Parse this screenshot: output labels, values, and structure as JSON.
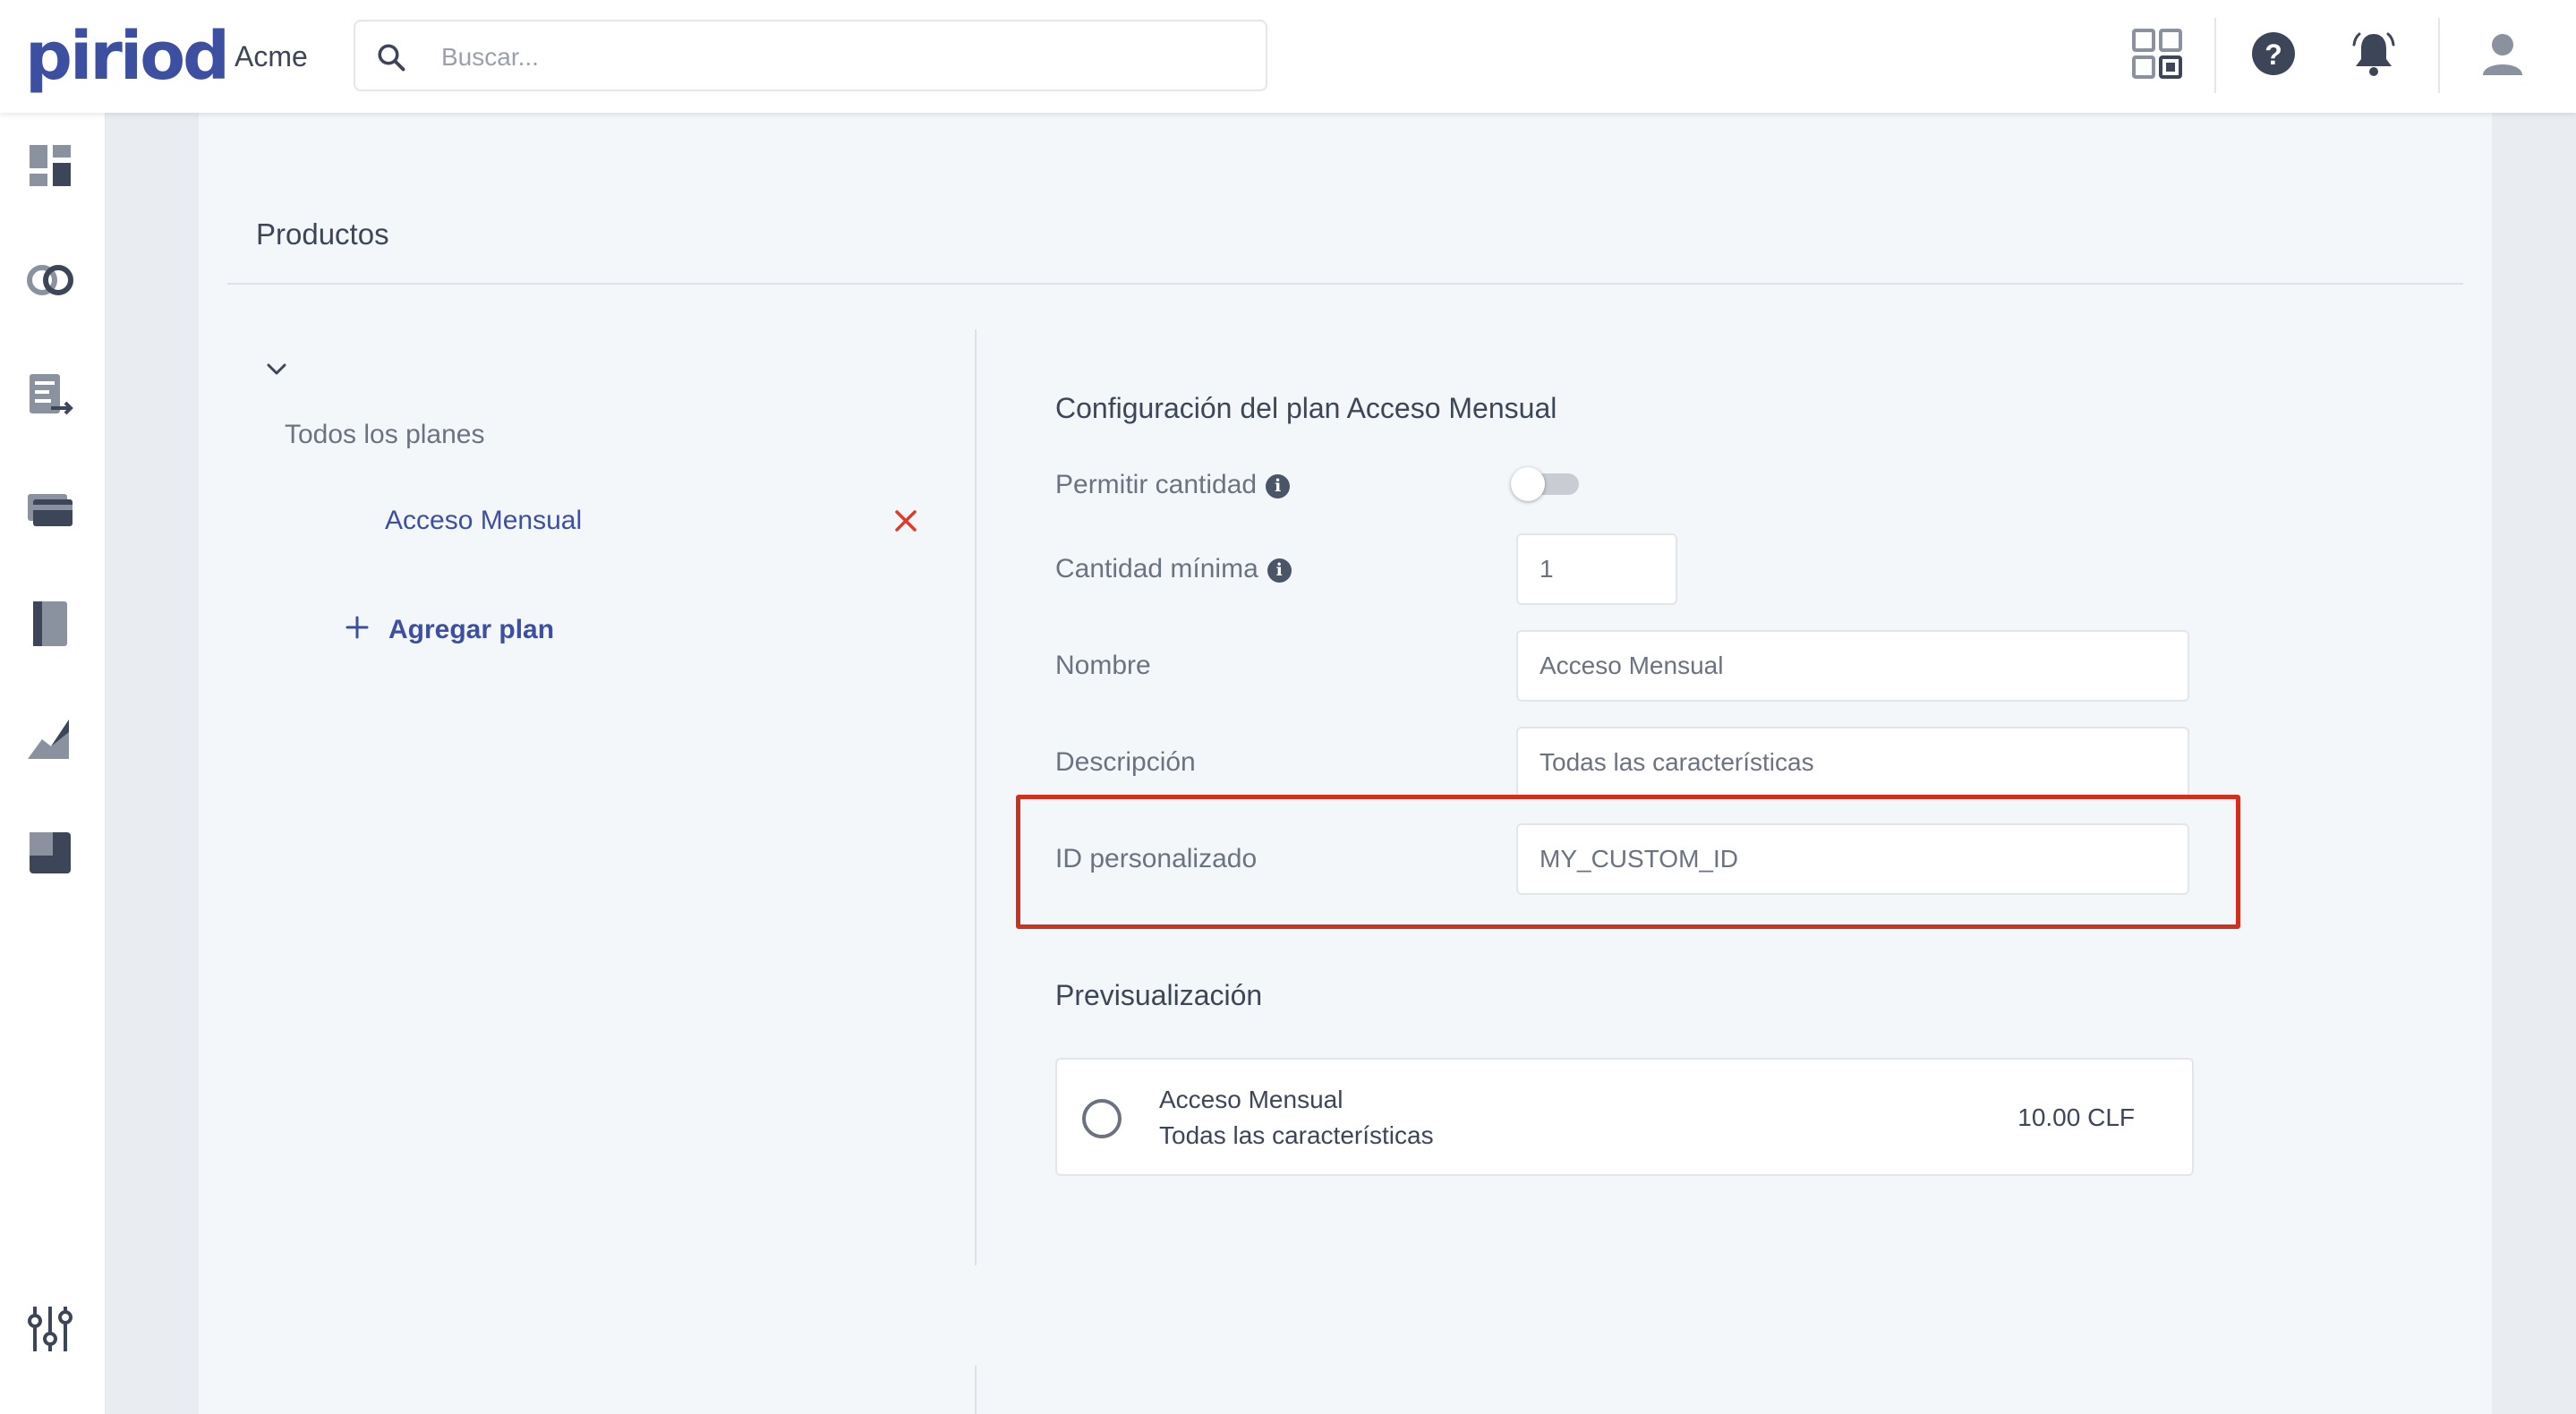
{
  "header": {
    "logo": "piriod",
    "org_name": "Acme",
    "search_placeholder": "Buscar...",
    "icons": [
      "apps-grid-icon",
      "help-icon",
      "bell-icon",
      "user-icon"
    ]
  },
  "sidebar": {
    "icons": [
      "dashboard-icon",
      "integrations-icon",
      "documents-icon",
      "payments-icon",
      "catalog-icon",
      "reports-icon",
      "apps-icon",
      "settings-icon"
    ]
  },
  "products": {
    "title": "Productos",
    "tree": {
      "all_plans_label": "Todos los planes",
      "plans": [
        {
          "label": "Acceso Mensual"
        }
      ],
      "add_plan_label": "Agregar plan"
    },
    "config": {
      "title": "Configuración del plan Acceso Mensual",
      "allow_quantity_label": "Permitir cantidad",
      "allow_quantity_enabled": false,
      "min_quantity_label": "Cantidad mínima",
      "min_quantity_value": "1",
      "name_label": "Nombre",
      "name_value": "Acceso Mensual",
      "description_label": "Descripción",
      "description_value": "Todas las características",
      "custom_id_label": "ID personalizado",
      "custom_id_value": "MY_CUSTOM_ID"
    },
    "preview": {
      "title": "Previsualización",
      "plan_name": "Acceso Mensual",
      "plan_description": "Todas las características",
      "price": "10.00 CLF"
    }
  },
  "colors": {
    "brand": "#3d4fa1",
    "highlight": "#d1301c",
    "delete": "#e0392c"
  }
}
